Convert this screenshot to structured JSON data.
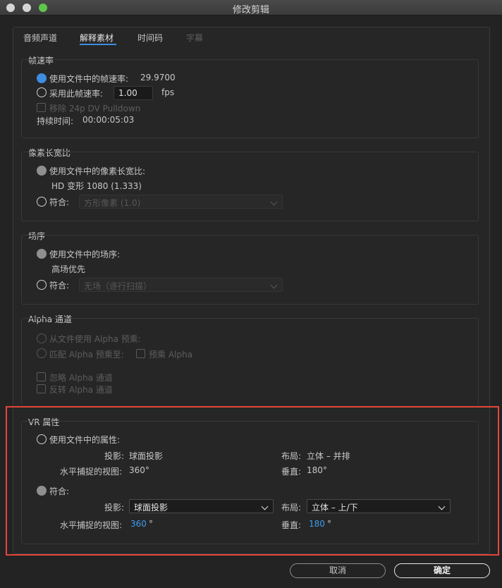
{
  "window": {
    "title": "修改剪辑"
  },
  "tabs": [
    {
      "label": "音频声道",
      "state": "normal"
    },
    {
      "label": "解释素材",
      "state": "active"
    },
    {
      "label": "时间码",
      "state": "normal"
    },
    {
      "label": "字幕",
      "state": "disabled"
    }
  ],
  "frame_rate": {
    "title": "帧速率",
    "use_file_label": "使用文件中的帧速率:",
    "use_file_value": "29.9700",
    "assume_label": "采用此帧速率:",
    "assume_value": "1.00",
    "assume_unit": "fps",
    "pulldown_label": "移除 24p DV Pulldown",
    "duration_label": "持续时间:",
    "duration_value": "00:00:05:03"
  },
  "pixel_aspect": {
    "title": "像素长宽比",
    "use_file_label": "使用文件中的像素长宽比:",
    "use_file_value": "HD 变形 1080 (1.333)",
    "conform_label": "符合:",
    "conform_select": "方形像素 (1.0)"
  },
  "field_order": {
    "title": "场序",
    "use_file_label": "使用文件中的场序:",
    "use_file_value": "高场优先",
    "conform_label": "符合:",
    "conform_select": "无场（逐行扫描）"
  },
  "alpha": {
    "title": "Alpha 通道",
    "from_file_label": "从文件使用 Alpha 预乘:",
    "match_label": "匹配 Alpha 预乘至:",
    "premult_label": "预乘 Alpha",
    "ignore_label": "忽略 Alpha 通道",
    "invert_label": "反转 Alpha 通道"
  },
  "vr": {
    "title": "VR 属性",
    "use_file_label": "使用文件中的属性:",
    "projection_label": "投影:",
    "projection_value": "球面投影",
    "layout_label": "布局:",
    "layout_value": "立体 – 并排",
    "h_view_label": "水平捕捉的视图:",
    "h_view_value": "360°",
    "v_label": "垂直:",
    "v_value": "180°",
    "conform_label": "符合:",
    "conform_projection_label": "投影:",
    "conform_projection_select": "球面投影",
    "conform_layout_label": "布局:",
    "conform_layout_select": "立体 – 上/下",
    "conform_h_view_label": "水平捕捉的视图:",
    "conform_h_view_value": "360",
    "conform_v_label": "垂直:",
    "conform_v_value": "180",
    "degree": "°"
  },
  "buttons": {
    "cancel": "取消",
    "ok": "确定"
  },
  "colors": {
    "accent": "#3d8de0",
    "highlight": "#e4463a"
  }
}
